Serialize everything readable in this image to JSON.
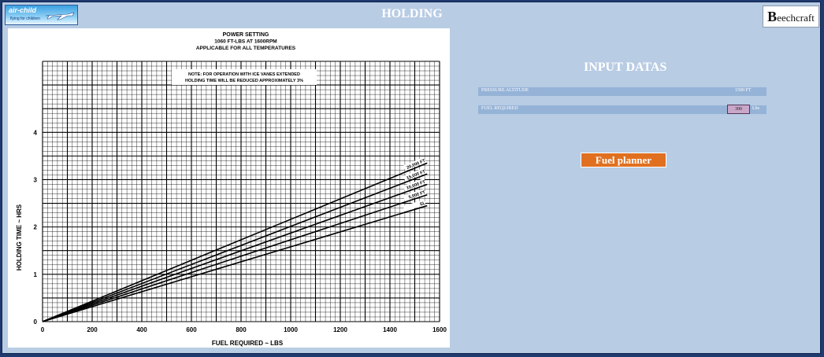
{
  "header": {
    "title": "HOLDING",
    "logo_left_brand": "air-child",
    "logo_left_sub": "flying for children",
    "logo_right_initial": "B",
    "logo_right_rest": "eechcraft"
  },
  "input_panel": {
    "title": "INPUT DATAS",
    "pressure_altitude_label": "PRESSURE ALTITUDE",
    "pressure_altitude_value": "1500",
    "pressure_altitude_unit": "FT",
    "fuel_required_label": "FUEL REQUIRED",
    "fuel_required_value": "300",
    "fuel_required_unit": "Lbs",
    "button_label": "Fuel planner"
  },
  "chart_data": {
    "type": "line",
    "title": "POWER SETTING",
    "subtitle_lines": [
      "1060 FT-LBS AT 1600RPM",
      "APPLICABLE FOR ALL TEMPERATURES"
    ],
    "note_lines": [
      "NOTE: FOR OPERATION WITH ICE VANES EXTENDED",
      "HOLDING TIME WILL BE REDUCED APPROXIMATELY 3%"
    ],
    "xlabel": "FUEL REQUIRED ~ LBS",
    "ylabel": "HOLDING TIME ~ HRS",
    "xlim": [
      0,
      1600
    ],
    "ylim": [
      0,
      5.5
    ],
    "x_ticks": [
      0,
      200,
      400,
      600,
      800,
      1000,
      1200,
      1400,
      1600
    ],
    "y_ticks": [
      0,
      1,
      2,
      3,
      4
    ],
    "grid": true,
    "series": [
      {
        "name": "20,000 FT",
        "x": [
          0,
          1550
        ],
        "y": [
          0,
          3.35
        ]
      },
      {
        "name": "15,000 FT",
        "x": [
          0,
          1550
        ],
        "y": [
          0,
          3.12
        ]
      },
      {
        "name": "10,000 FT",
        "x": [
          0,
          1550
        ],
        "y": [
          0,
          2.9
        ]
      },
      {
        "name": "5,000 FT",
        "x": [
          0,
          1550
        ],
        "y": [
          0,
          2.68
        ]
      },
      {
        "name": "SL",
        "x": [
          0,
          1550
        ],
        "y": [
          0,
          2.45
        ]
      }
    ],
    "colors": {
      "line": "#000000",
      "grid": "#000000"
    }
  }
}
